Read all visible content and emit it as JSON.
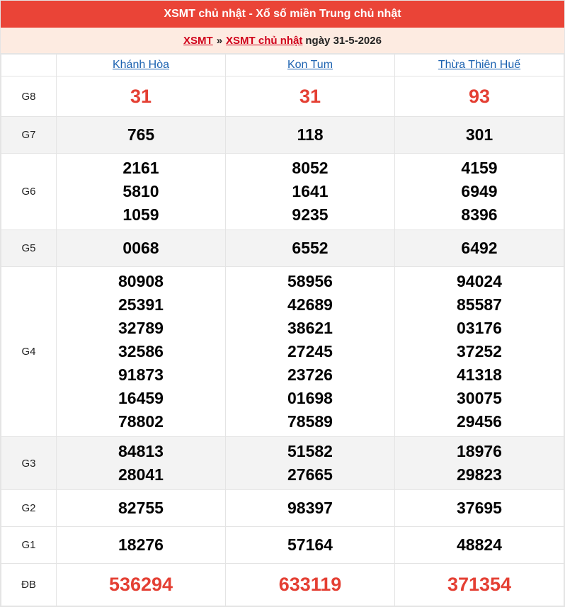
{
  "header": {
    "title": "XSMT chủ nhật - Xổ số miền Trung chủ nhật"
  },
  "breadcrumb": {
    "link1": "XSMT",
    "separator": "»",
    "link2": "XSMT chủ nhật",
    "date": "ngày 31-5-2026"
  },
  "provinces": [
    "Khánh Hòa",
    "Kon Tum",
    "Thừa Thiên Huế"
  ],
  "prizes": [
    {
      "label": "G8",
      "highlight": true,
      "gray": false,
      "values": [
        [
          "31"
        ],
        [
          "31"
        ],
        [
          "93"
        ]
      ]
    },
    {
      "label": "G7",
      "highlight": false,
      "gray": true,
      "values": [
        [
          "765"
        ],
        [
          "118"
        ],
        [
          "301"
        ]
      ]
    },
    {
      "label": "G6",
      "highlight": false,
      "gray": false,
      "values": [
        [
          "2161",
          "5810",
          "1059"
        ],
        [
          "8052",
          "1641",
          "9235"
        ],
        [
          "4159",
          "6949",
          "8396"
        ]
      ]
    },
    {
      "label": "G5",
      "highlight": false,
      "gray": true,
      "values": [
        [
          "0068"
        ],
        [
          "6552"
        ],
        [
          "6492"
        ]
      ]
    },
    {
      "label": "G4",
      "highlight": false,
      "gray": false,
      "values": [
        [
          "80908",
          "25391",
          "32789",
          "32586",
          "91873",
          "16459",
          "78802"
        ],
        [
          "58956",
          "42689",
          "38621",
          "27245",
          "23726",
          "01698",
          "78589"
        ],
        [
          "94024",
          "85587",
          "03176",
          "37252",
          "41318",
          "30075",
          "29456"
        ]
      ]
    },
    {
      "label": "G3",
      "highlight": false,
      "gray": true,
      "values": [
        [
          "84813",
          "28041"
        ],
        [
          "51582",
          "27665"
        ],
        [
          "18976",
          "29823"
        ]
      ]
    },
    {
      "label": "G2",
      "highlight": false,
      "gray": false,
      "values": [
        [
          "82755"
        ],
        [
          "98397"
        ],
        [
          "37695"
        ]
      ]
    },
    {
      "label": "G1",
      "highlight": false,
      "gray": false,
      "values": [
        [
          "18276"
        ],
        [
          "57164"
        ],
        [
          "48824"
        ]
      ]
    },
    {
      "label": "ĐB",
      "highlight": true,
      "gray": false,
      "values": [
        [
          "536294"
        ],
        [
          "633119"
        ],
        [
          "371354"
        ]
      ]
    }
  ]
}
